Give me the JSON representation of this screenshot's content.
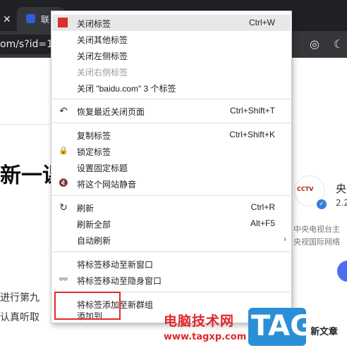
{
  "browser": {
    "tab_title": "联",
    "url_text": "om/s?id=1",
    "close_glyph": "✕",
    "camera_glyph": "◎",
    "moon_glyph": "☾",
    "more_glyph": "⋯"
  },
  "page": {
    "headline": "新一课",
    "side": {
      "logo_text": "CCTV",
      "verified_glyph": "✓",
      "name": "央",
      "num": "2.2",
      "desc1": "中央电视台主",
      "desc2": "央视国际网络"
    },
    "body_line1": "进行第九",
    "body_line2": "认真听取",
    "side_bottom": "新文章"
  },
  "context_menu": {
    "items": [
      {
        "label": "关闭标签",
        "shortcut": "Ctrl+W",
        "icon": "close-tab-icon"
      },
      {
        "label": "关闭其他标签",
        "shortcut": ""
      },
      {
        "label": "关闭左侧标签",
        "shortcut": ""
      },
      {
        "label": "关闭右侧标签",
        "shortcut": "",
        "disabled": true
      },
      {
        "label": "关闭 \"baidu.com\" 3 个标签",
        "shortcut": ""
      },
      {
        "label": "恢复最近关闭页面",
        "shortcut": "Ctrl+Shift+T",
        "icon": "undo-icon"
      },
      {
        "label": "复制标签",
        "shortcut": "Ctrl+Shift+K"
      },
      {
        "label": "锁定标签",
        "shortcut": "",
        "icon": "lock-icon"
      },
      {
        "label": "设置固定标题",
        "shortcut": ""
      },
      {
        "label": "将这个网站静音",
        "shortcut": "",
        "icon": "mute-icon"
      },
      {
        "label": "刷新",
        "shortcut": "Ctrl+R",
        "icon": "refresh-icon"
      },
      {
        "label": "刷新全部",
        "shortcut": "Alt+F5"
      },
      {
        "label": "自动刷新",
        "shortcut": "",
        "submenu": true
      },
      {
        "label": "将标签移动至新窗口",
        "shortcut": ""
      },
      {
        "label": "将标签移动至隐身窗口",
        "shortcut": "",
        "icon": "incognito-icon"
      },
      {
        "label": "将标签添加至新群组",
        "shortcut": ""
      },
      {
        "label": "添加到",
        "shortcut": ""
      }
    ],
    "icons": {
      "undo": "↶",
      "lock": "🔒",
      "mute": "🔇",
      "refresh": "↻",
      "incognito": "👓",
      "submenu_arrow": "›"
    }
  },
  "watermark": {
    "main": "电脑技术网",
    "url": "www.tagxp.com",
    "tag": "TAG"
  }
}
